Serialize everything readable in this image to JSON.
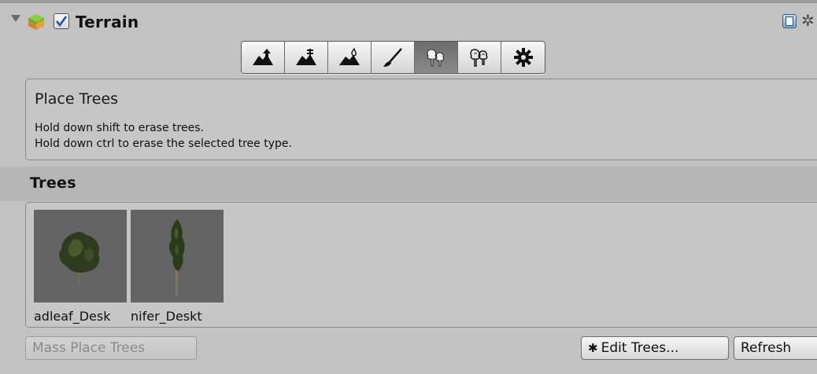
{
  "header": {
    "title": "Terrain",
    "enabled": true,
    "foldout_icon": "triangle-down-icon",
    "component_icon": "terrain-cube-icon",
    "help_icon": "help-book-icon",
    "settings_icon": "gear-icon"
  },
  "toolbar": {
    "tools": [
      {
        "icon": "raise-lower-terrain-icon",
        "active": false
      },
      {
        "icon": "paint-height-icon",
        "active": false
      },
      {
        "icon": "smooth-height-icon",
        "active": false
      },
      {
        "icon": "paint-texture-icon",
        "active": false
      },
      {
        "icon": "place-trees-icon",
        "active": true
      },
      {
        "icon": "paint-details-icon",
        "active": false
      },
      {
        "icon": "terrain-settings-icon",
        "active": false
      }
    ]
  },
  "description": {
    "title": "Place Trees",
    "line1": "Hold down shift to erase trees.",
    "line2": "Hold down ctrl to erase the selected tree type."
  },
  "trees_section": {
    "title": "Trees",
    "items": [
      {
        "label": "adleaf_Desk",
        "icon": "broadleaf-tree-icon"
      },
      {
        "label": "nifer_Deskt",
        "icon": "conifer-tree-icon"
      }
    ]
  },
  "buttons": {
    "mass_place": "Mass Place Trees",
    "edit_trees": "Edit Trees...",
    "refresh": "Refresh"
  },
  "colors": {
    "background": "#c2c2c2",
    "active_tool": "#7a7a7a",
    "thumbnail_bg": "#646464"
  }
}
